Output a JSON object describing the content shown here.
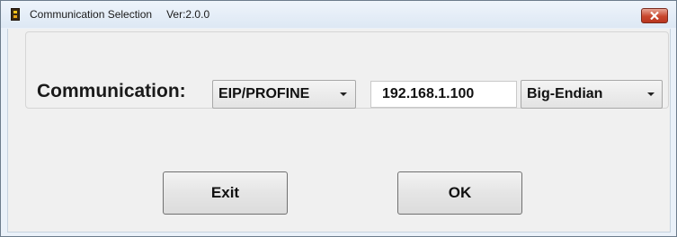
{
  "window": {
    "title": "Communication Selection",
    "version": "Ver:2.0.0",
    "icon": "plc-device-icon",
    "close_icon": "close-icon"
  },
  "form": {
    "label": "Communication:",
    "protocol": {
      "selected": "EIP/PROFINE",
      "icon": "dropdown-arrow-icon"
    },
    "ip_address": "192.168.1.100",
    "byte_order": {
      "selected": "Big-Endian",
      "icon": "dropdown-arrow-icon"
    }
  },
  "buttons": {
    "exit": "Exit",
    "ok": "OK"
  },
  "colors": {
    "close_button": "#c8462d",
    "title_bar": "#dde8f4",
    "client_background": "#f0f0f0"
  }
}
